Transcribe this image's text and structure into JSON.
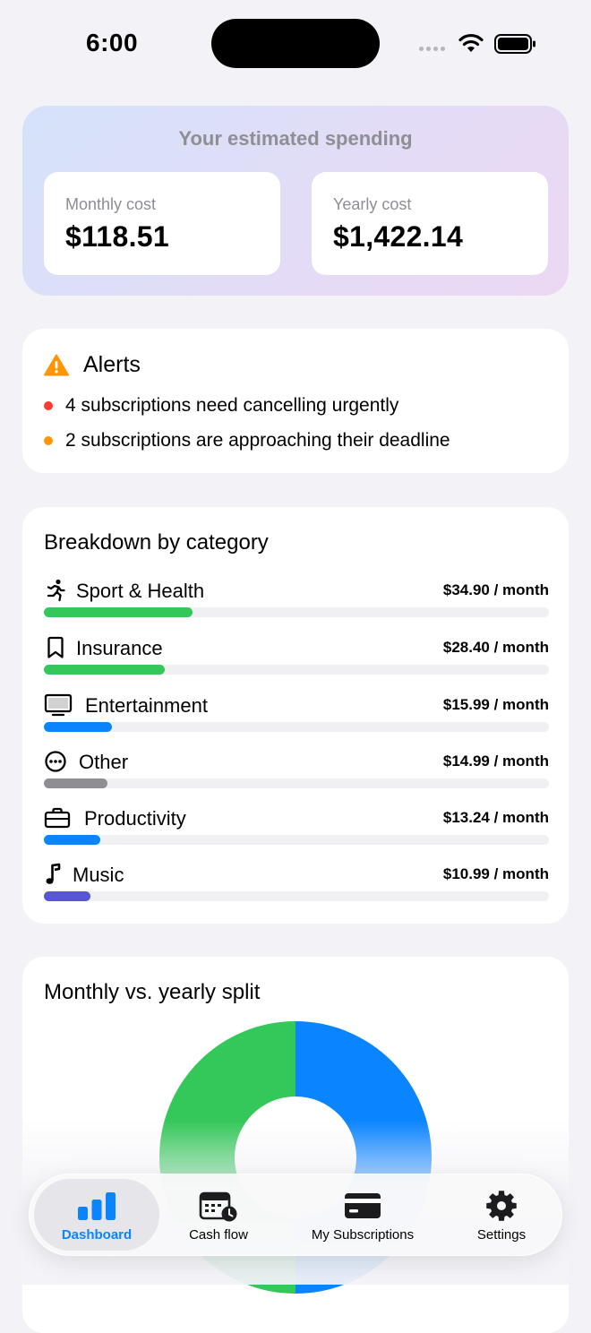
{
  "status_bar": {
    "time": "6:00"
  },
  "spending": {
    "title": "Your estimated spending",
    "monthly_label": "Monthly cost",
    "monthly_value": "$118.51",
    "yearly_label": "Yearly cost",
    "yearly_value": "$1,422.14"
  },
  "alerts": {
    "title": "Alerts",
    "items": [
      {
        "text": "4 subscriptions need cancelling urgently",
        "color": "#ff3b30"
      },
      {
        "text": "2 subscriptions are approaching their deadline",
        "color": "#ff9500"
      }
    ]
  },
  "breakdown": {
    "title": "Breakdown by category",
    "items": [
      {
        "label": "Sport & Health",
        "amount": "$34.90 / month",
        "icon": "running-icon",
        "share": 0.294,
        "color": "#34c759"
      },
      {
        "label": "Insurance",
        "amount": "$28.40 / month",
        "icon": "bookmark-icon",
        "share": 0.24,
        "color": "#34c759"
      },
      {
        "label": "Entertainment",
        "amount": "$15.99 / month",
        "icon": "monitor-icon",
        "share": 0.135,
        "color": "#0a84ff"
      },
      {
        "label": "Other",
        "amount": "$14.99 / month",
        "icon": "ellipsis-circle-icon",
        "share": 0.126,
        "color": "#8e8e93"
      },
      {
        "label": "Productivity",
        "amount": "$13.24 / month",
        "icon": "briefcase-icon",
        "share": 0.112,
        "color": "#0a84ff"
      },
      {
        "label": "Music",
        "amount": "$10.99 / month",
        "icon": "music-note-icon",
        "share": 0.093,
        "color": "#5856d6"
      }
    ]
  },
  "split": {
    "title": "Monthly vs. yearly split"
  },
  "chart_data": {
    "type": "pie",
    "title": "Monthly vs. yearly split",
    "values": [
      0.5,
      0.5
    ],
    "colors": [
      "#0a84ff",
      "#34c759"
    ]
  },
  "tabs": [
    {
      "label": "Dashboard",
      "icon": "bar-chart-icon",
      "active": true
    },
    {
      "label": "Cash flow",
      "icon": "calendar-clock-icon",
      "active": false
    },
    {
      "label": "My Subscriptions",
      "icon": "credit-card-icon",
      "active": false
    },
    {
      "label": "Settings",
      "icon": "gear-icon",
      "active": false
    }
  ]
}
